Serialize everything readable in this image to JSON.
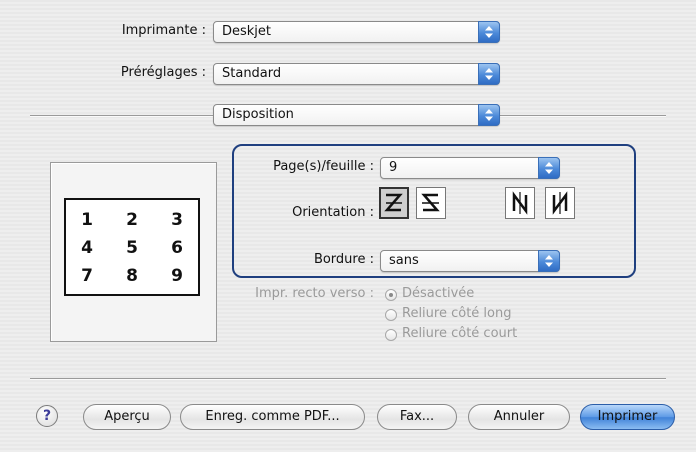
{
  "printer": {
    "label": "Imprimante :",
    "value": "Deskjet"
  },
  "presets": {
    "label": "Préréglages :",
    "value": "Standard"
  },
  "panel": {
    "value": "Disposition"
  },
  "layout": {
    "pages_label": "Page(s)/feuille :",
    "pages_value": "9",
    "orientation_label": "Orientation :",
    "orientation_selected": 1,
    "border_label": "Bordure :",
    "border_value": "sans",
    "preview_numbers": [
      "1",
      "2",
      "3",
      "4",
      "5",
      "6",
      "7",
      "8",
      "9"
    ]
  },
  "duplex": {
    "label": "Impr. recto verso :",
    "options": [
      "Désactivée",
      "Reliure côté long",
      "Reliure côté court"
    ],
    "selected": 0
  },
  "buttons": {
    "help": "?",
    "preview": "Aperçu",
    "save_pdf": "Enreg. comme PDF...",
    "fax": "Fax...",
    "cancel": "Annuler",
    "print": "Imprimer"
  },
  "colors": {
    "accent": "#4c8ad9",
    "group_border": "#1f3f7f"
  }
}
